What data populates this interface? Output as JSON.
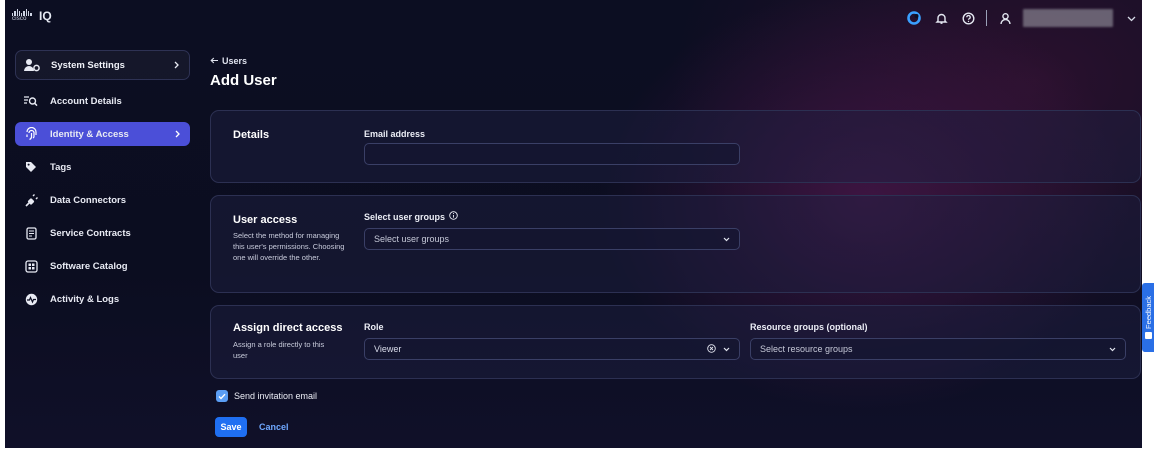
{
  "header": {
    "logo_text": "cisco",
    "app_name": "IQ",
    "user_name": ""
  },
  "sidebar": {
    "parent": {
      "label": "System Settings",
      "icon": "users-gear-icon"
    },
    "items": [
      {
        "label": "Account Details",
        "icon": "list-search-icon",
        "active": false
      },
      {
        "label": "Identity & Access",
        "icon": "fingerprint-icon",
        "active": true
      },
      {
        "label": "Tags",
        "icon": "tag-icon",
        "active": false
      },
      {
        "label": "Data Connectors",
        "icon": "plug-icon",
        "active": false
      },
      {
        "label": "Service Contracts",
        "icon": "contract-icon",
        "active": false
      },
      {
        "label": "Software Catalog",
        "icon": "catalog-icon",
        "active": false
      },
      {
        "label": "Activity & Logs",
        "icon": "activity-icon",
        "active": false
      }
    ]
  },
  "main": {
    "breadcrumb": "Users",
    "title": "Add User",
    "details": {
      "title": "Details",
      "email_label": "Email address",
      "email_value": ""
    },
    "user_access": {
      "title": "User access",
      "description": "Select the method for managing this user's permissions. Choosing one will override the other.",
      "groups_label": "Select user groups",
      "groups_placeholder": "Select user groups"
    },
    "direct_access": {
      "title": "Assign direct access",
      "description": "Assign a role directly to this user",
      "role_label": "Role",
      "role_value": "Viewer",
      "resource_label": "Resource groups (optional)",
      "resource_placeholder": "Select resource groups"
    },
    "invite_label": "Send invitation email",
    "invite_checked": true,
    "save_label": "Save",
    "cancel_label": "Cancel"
  },
  "feedback_label": "Feedback",
  "colors": {
    "accent": "#1f6ff2",
    "active_nav": "#4b4fd8",
    "link": "#6fa8ff",
    "background": "#0c0e22"
  }
}
